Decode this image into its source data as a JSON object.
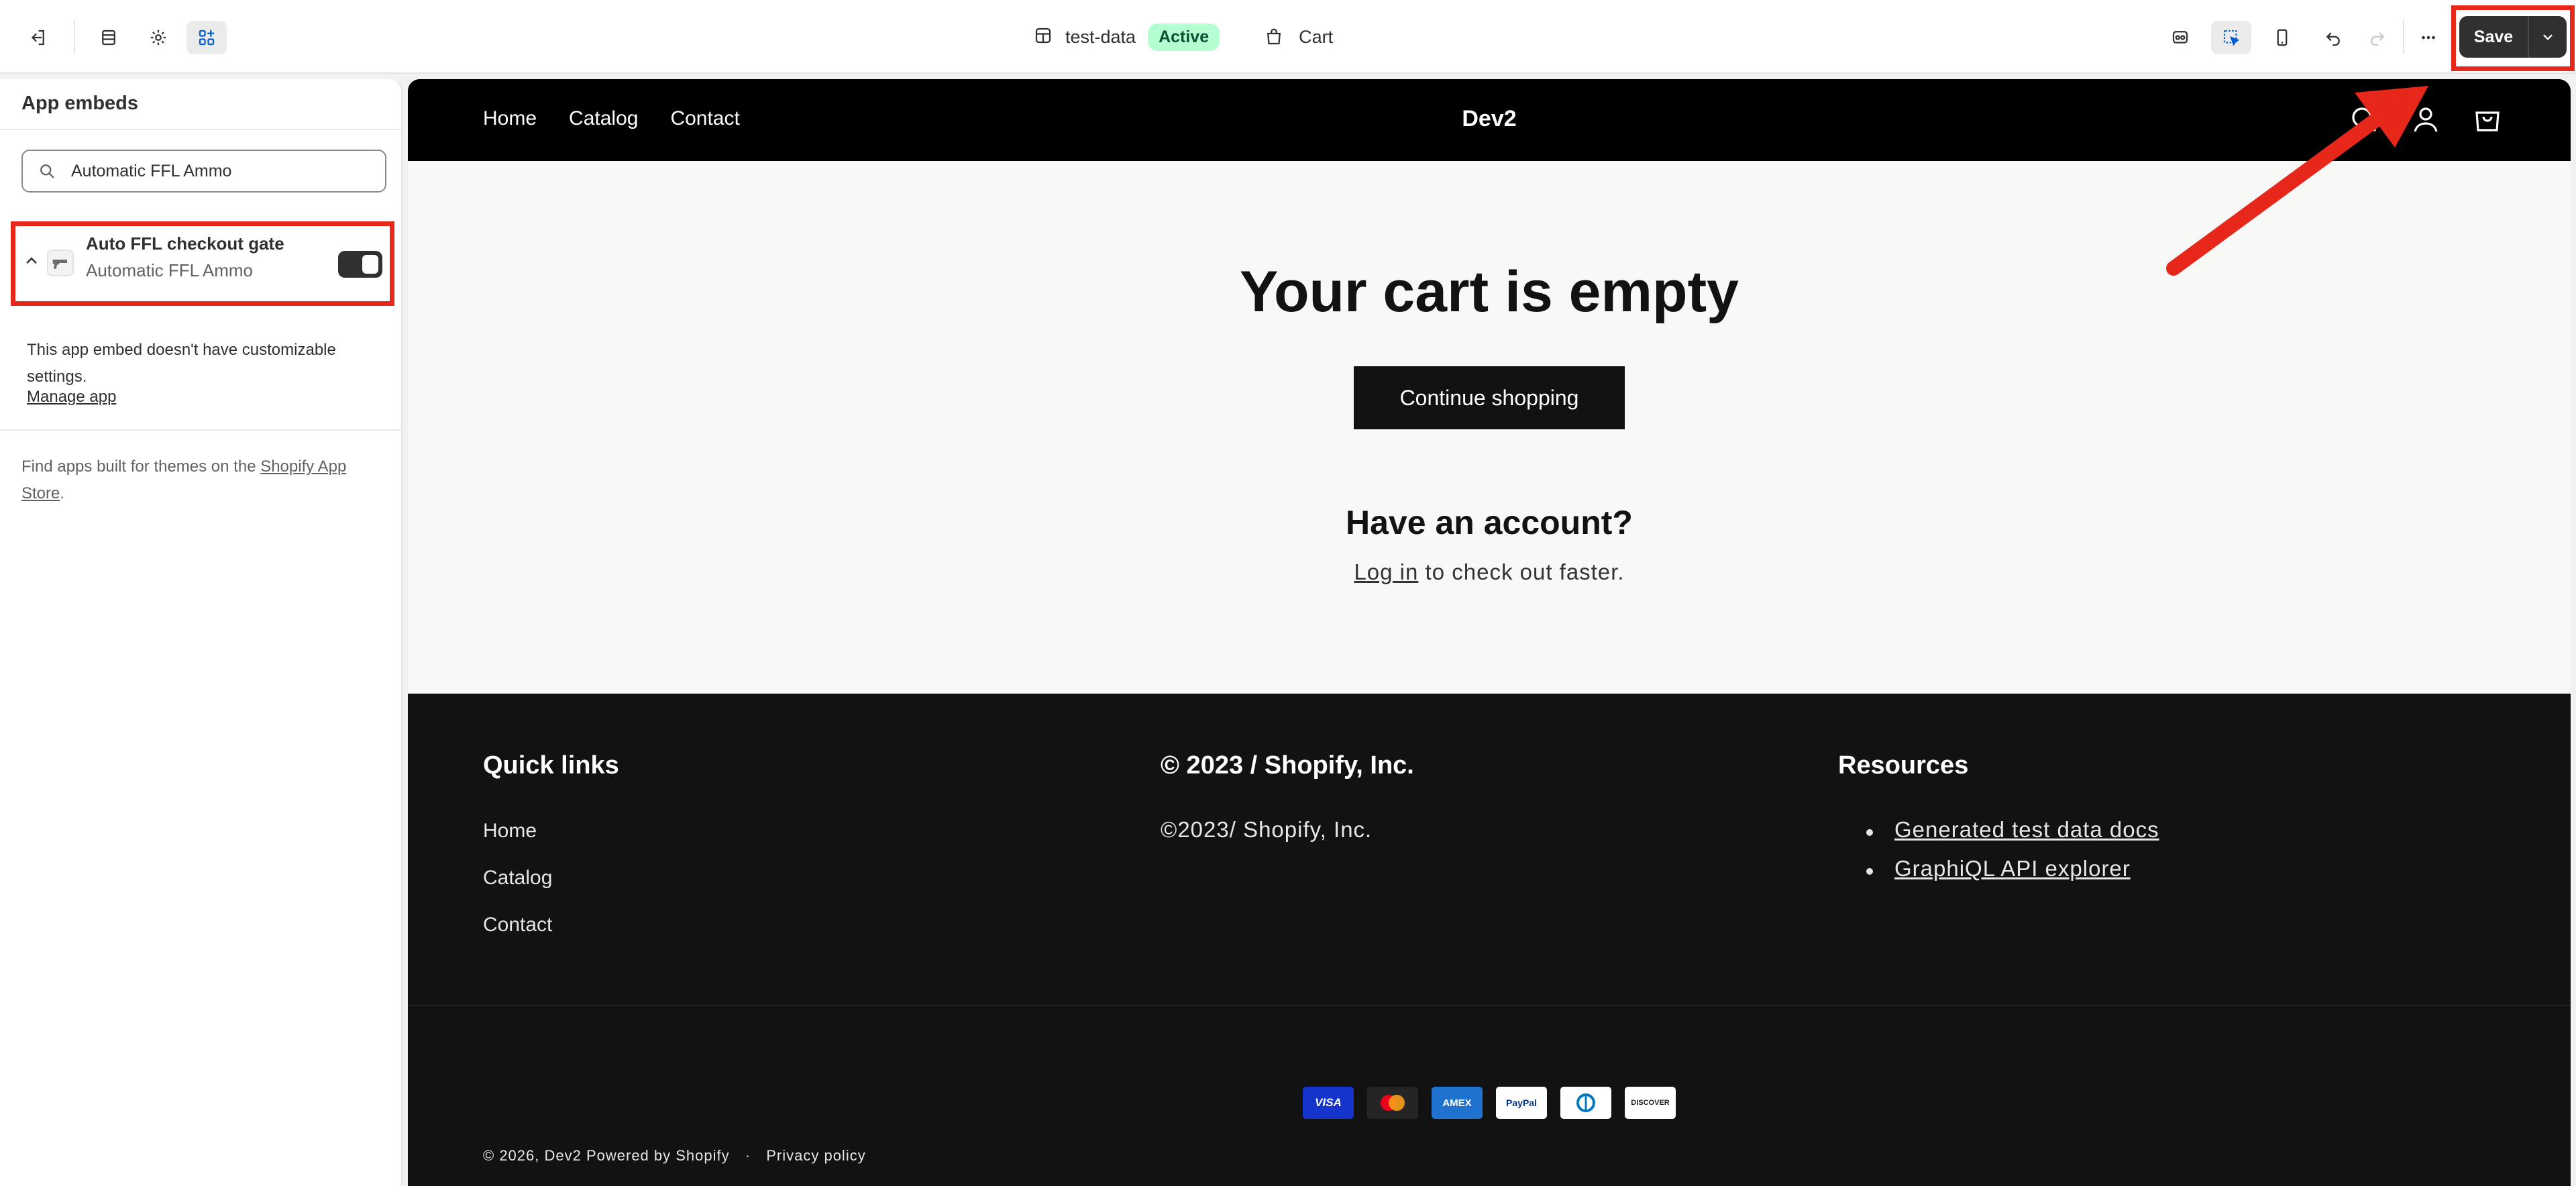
{
  "toolbar": {
    "theme_name": "test-data",
    "theme_status": "Active",
    "template_name": "Cart",
    "save_label": "Save",
    "icons": [
      "exit-icon",
      "sections-icon",
      "settings-icon",
      "app-embeds-icon",
      "theme-icon",
      "bag-icon",
      "inspector-icon",
      "select-icon",
      "mobile-icon",
      "undo-icon",
      "redo-icon",
      "more-icon",
      "chevron-down-icon"
    ]
  },
  "sidebar": {
    "title": "App embeds",
    "search": {
      "value": "Automatic FFL Ammo",
      "placeholder": ""
    },
    "embed": {
      "name": "Auto FFL checkout gate",
      "app": "Automatic FFL Ammo",
      "enabled": true
    },
    "note": "This app embed doesn't have customizable settings.",
    "manage_link": "Manage app",
    "find_apps_text": "Find apps built for themes on the ",
    "find_apps_link": "Shopify App Store",
    "find_apps_end": "."
  },
  "store": {
    "nav": [
      "Home",
      "Catalog",
      "Contact"
    ],
    "logo": "Dev2",
    "cart_title": "Your cart is empty",
    "continue_label": "Continue shopping",
    "account_title": "Have an account?",
    "login_link": "Log in",
    "login_text": " to check out faster."
  },
  "footer": {
    "quick_links_title": "Quick links",
    "quick_links": [
      "Home",
      "Catalog",
      "Contact"
    ],
    "company_title": "© 2023 / Shopify, Inc.",
    "company_text": "©2023/ Shopify, Inc.",
    "resources_title": "Resources",
    "resources": [
      "Generated test data docs",
      "GraphiQL API explorer"
    ],
    "payments": [
      "VISA",
      "MC",
      "AMEX",
      "PayPal",
      "Diners",
      "DISCOVER"
    ],
    "copyright": "© 2026, Dev2 Powered by Shopify",
    "policy": "Privacy policy"
  },
  "colors": {
    "annotation_red": "#e8271b",
    "save_bg": "#303030",
    "active_badge_bg": "#b4fed2"
  }
}
